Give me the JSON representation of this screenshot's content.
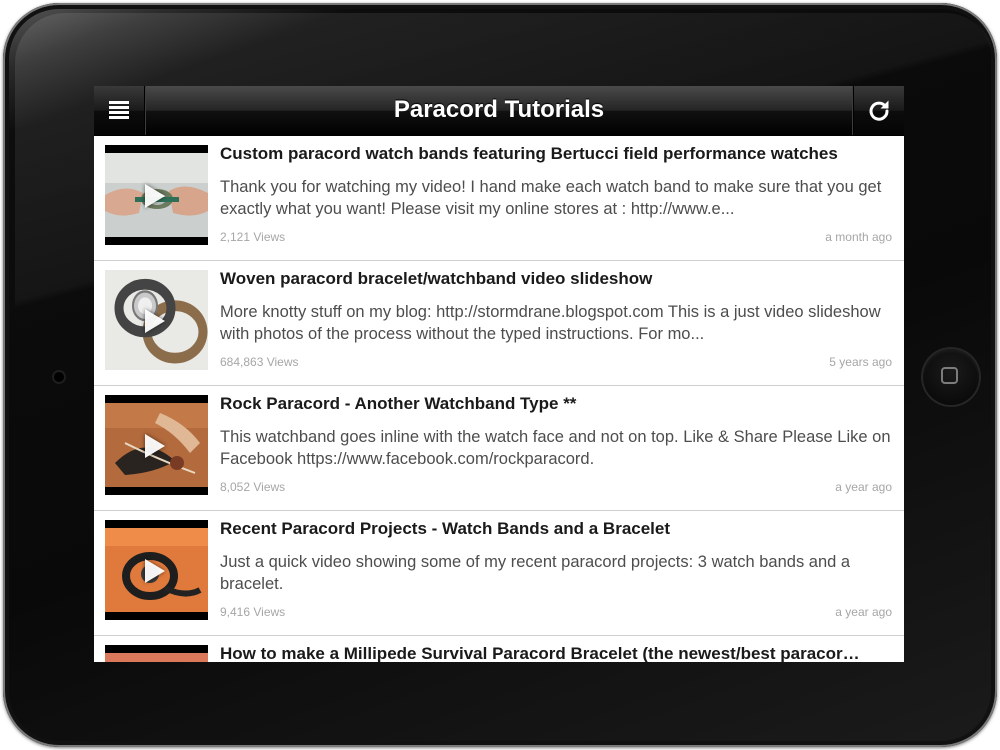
{
  "app": {
    "title": "Paracord Tutorials",
    "menu_icon": "hamburger-menu-icon",
    "refresh_icon": "refresh-icon"
  },
  "videos": [
    {
      "title": "Custom paracord watch bands featuring Bertucci field performance watches",
      "description": "Thank you for watching my video! I hand make each watch band to make sure that you get exactly what you want! Please visit my online stores at : http://www.e...",
      "views": "2,121 Views",
      "age": "a month ago"
    },
    {
      "title": "Woven paracord bracelet/watchband video slideshow",
      "description": "More knotty stuff on my blog: http://stormdrane.blogspot.com This is a just video slideshow with photos of the process without the typed instructions. For mo...",
      "views": "684,863 Views",
      "age": "5 years ago"
    },
    {
      "title": "Rock Paracord - Another Watchband Type **",
      "description": "This watchband goes inline with the watch face and not on top. Like & Share Please Like on Facebook https://www.facebook.com/rockparacord.",
      "views": "8,052 Views",
      "age": "a year ago"
    },
    {
      "title": "Recent Paracord Projects - Watch Bands and a Bracelet",
      "description": "Just a quick video showing some of my recent paracord projects: 3 watch bands and a bracelet.",
      "views": "9,416 Views",
      "age": "a year ago"
    },
    {
      "title": "How to make a Millipede Survival Paracord Bracelet (the newest/best paracor…",
      "description": "",
      "views": "",
      "age": ""
    }
  ],
  "colors": {
    "nav_bar": "#111111",
    "title_text": "#1a1a1a",
    "description_text": "#4d4d4d",
    "meta_text": "#a6a6a6"
  }
}
